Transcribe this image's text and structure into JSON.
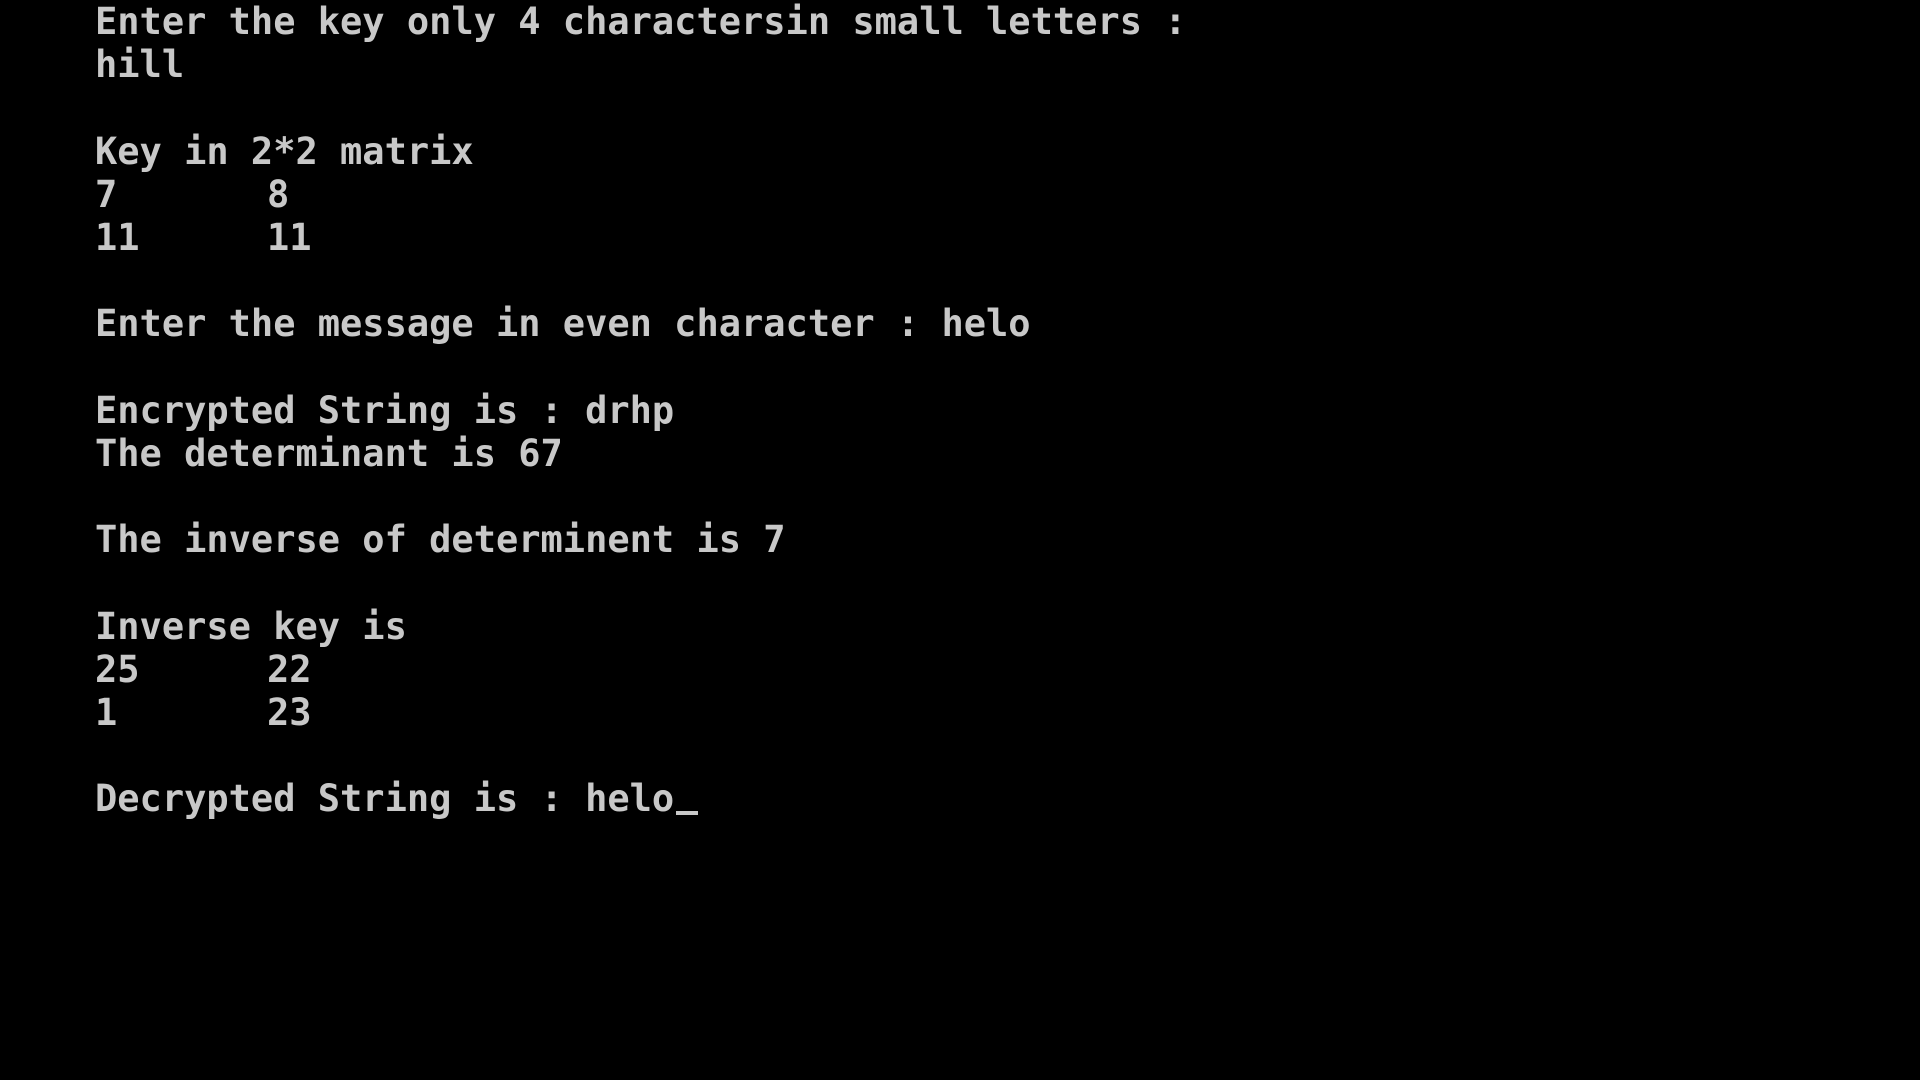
{
  "console": {
    "key_prompt": "Enter the key only 4 charactersin small letters :",
    "key_input": "hill",
    "key_matrix_heading": "Key in 2*2 matrix",
    "key_matrix": [
      [
        "7",
        "8"
      ],
      [
        "11",
        "11"
      ]
    ],
    "message_prompt": "Enter the message in even character : helo",
    "encrypted_line": "Encrypted String is : drhp",
    "determinant_line": "The determinant is 67",
    "inverse_determinant_line": "The inverse of determinent is 7",
    "inverse_key_heading": "Inverse key is",
    "inverse_key_matrix": [
      [
        "25",
        "22"
      ],
      [
        "1",
        "23"
      ]
    ],
    "decrypted_line": "Decrypted String is : helo"
  },
  "colors": {
    "background": "#000000",
    "foreground": "#c8c8c8"
  }
}
